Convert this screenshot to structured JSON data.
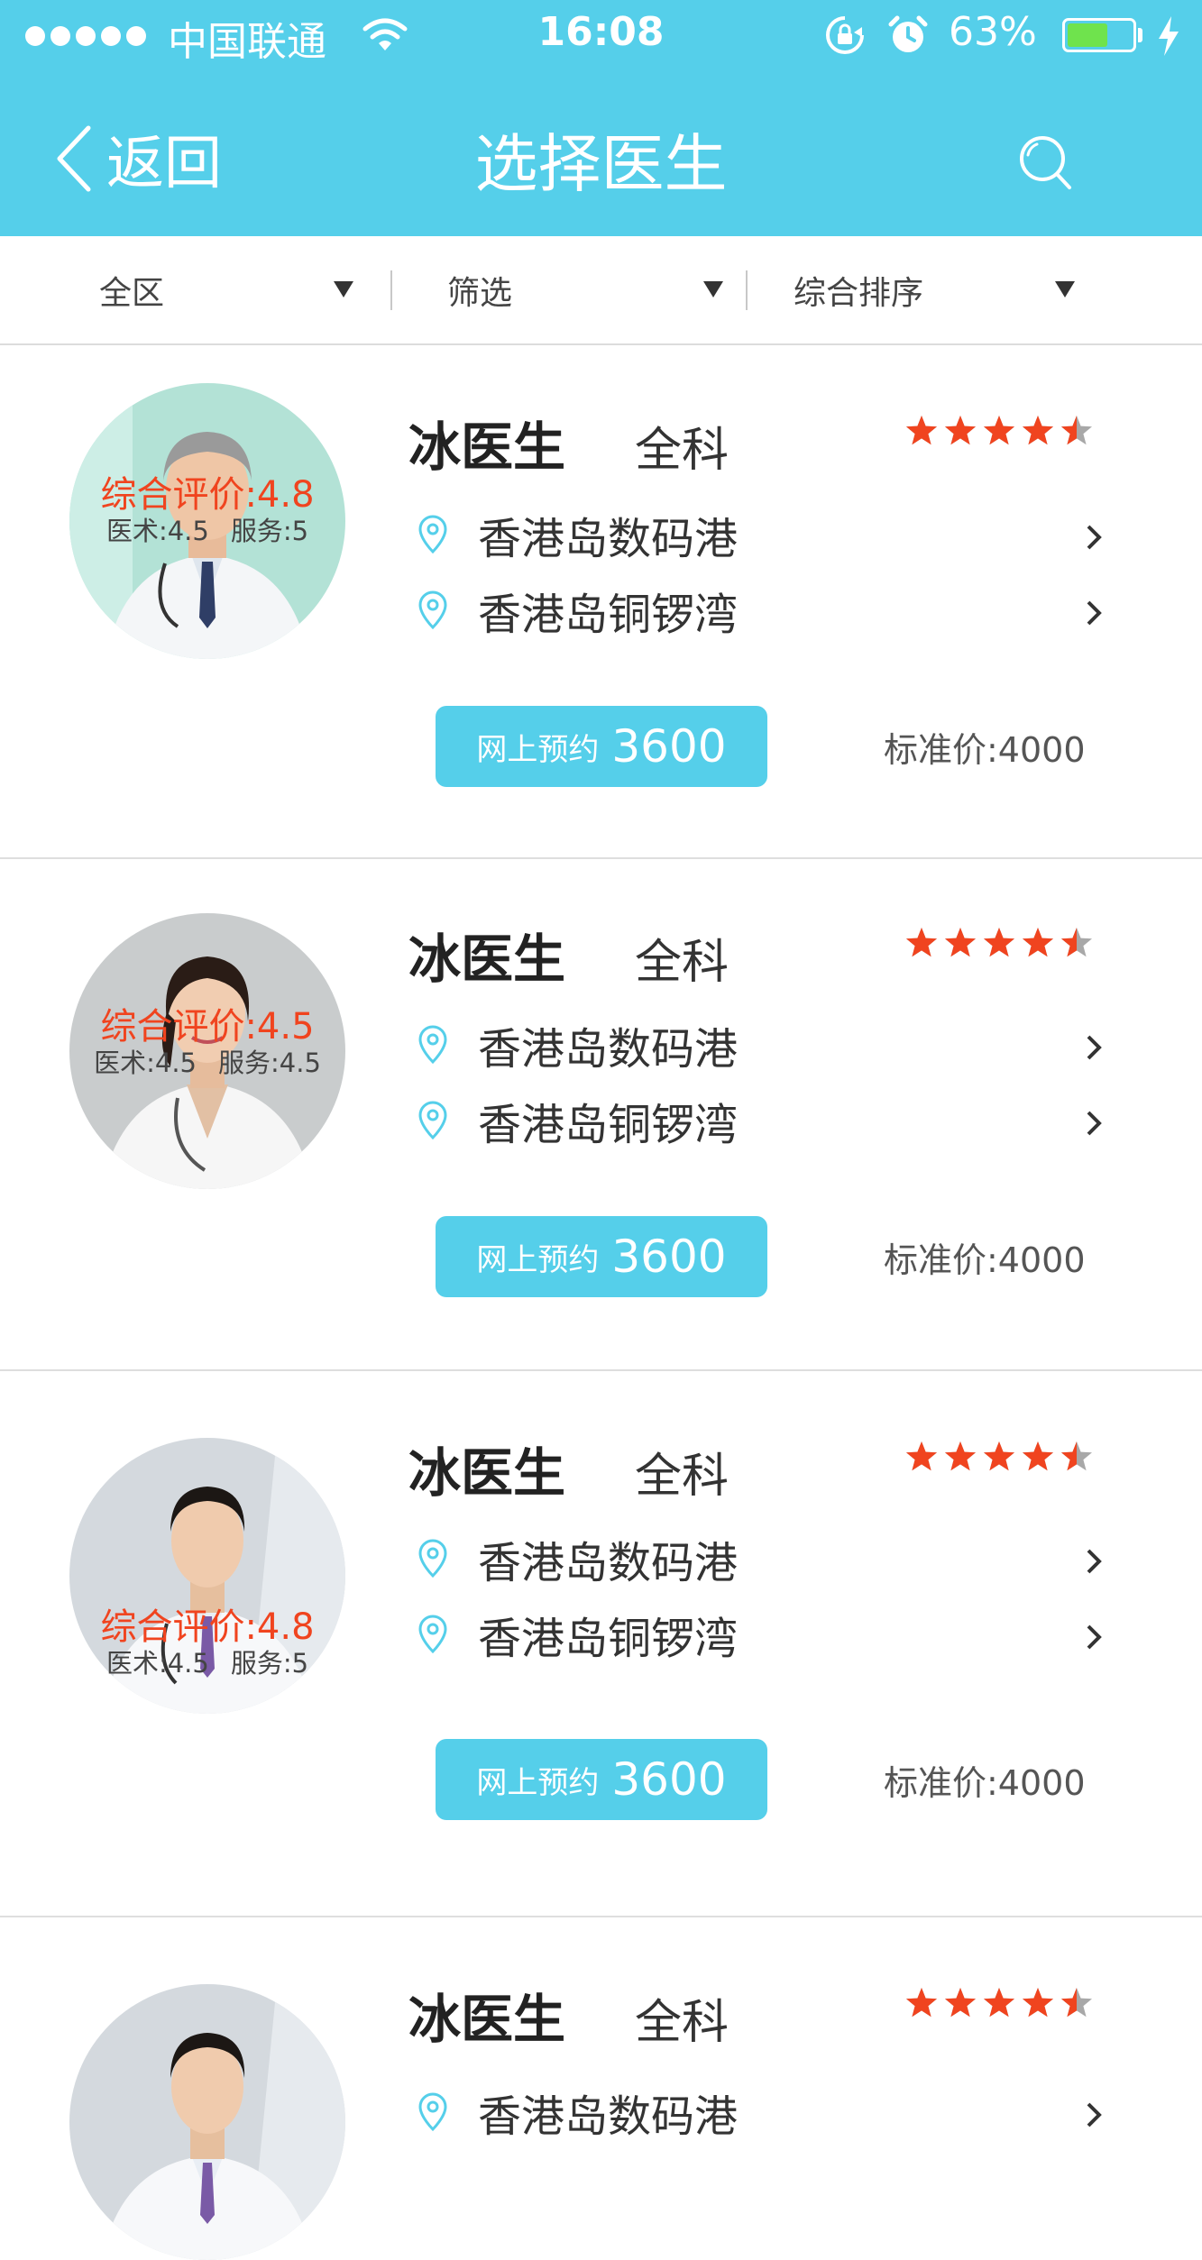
{
  "status_bar": {
    "carrier": "中国联通",
    "time": "16:08",
    "battery": "63%",
    "battery_level": 0.63,
    "icons": [
      "signal-dots-icon",
      "wifi-icon",
      "rotation-lock-icon",
      "alarm-icon",
      "battery-icon",
      "charging-bolt-icon"
    ]
  },
  "nav": {
    "back_label": "返回",
    "title": "选择医生",
    "icons": [
      "back-chevron-icon",
      "search-icon"
    ]
  },
  "filters": [
    {
      "label": "全区",
      "icon": "dropdown-triangle-icon"
    },
    {
      "label": "筛选",
      "icon": "dropdown-triangle-icon"
    },
    {
      "label": "综合排序",
      "icon": "dropdown-triangle-icon"
    }
  ],
  "doctors": [
    {
      "name": "冰医生",
      "dept": "全科",
      "rating": 4.5,
      "overall": "综合评价:4.8",
      "skill": "医术:4.5",
      "service": "服务:5",
      "locations": [
        "香港岛数码港",
        "香港岛铜锣湾"
      ],
      "book_label": "网上预约",
      "book_price": "3600",
      "standard_price": "标准价:4000",
      "avatar": "elderly-male-doctor-photo"
    },
    {
      "name": "冰医生",
      "dept": "全科",
      "rating": 4.5,
      "overall": "综合评价:4.5",
      "skill": "医术:4.5",
      "service": "服务:4.5",
      "locations": [
        "香港岛数码港",
        "香港岛铜锣湾"
      ],
      "book_label": "网上预约",
      "book_price": "3600",
      "standard_price": "标准价:4000",
      "avatar": "female-doctor-photo"
    },
    {
      "name": "冰医生",
      "dept": "全科",
      "rating": 4.5,
      "overall": "综合评价:4.8",
      "skill": "医术:4.5",
      "service": "服务:5",
      "locations": [
        "香港岛数码港",
        "香港岛铜锣湾"
      ],
      "book_label": "网上预约",
      "book_price": "3600",
      "standard_price": "标准价:4000",
      "avatar": "young-male-doctor-photo"
    },
    {
      "name": "冰医生",
      "dept": "全科",
      "rating": 4.5,
      "locations": [
        "香港岛数码港"
      ],
      "avatar": "young-male-doctor-photo"
    }
  ],
  "colors": {
    "accent": "#55cfea",
    "star": "#f0441f",
    "rating_text": "#f0441f",
    "star_empty": "#a8a8a8",
    "pin": "#55cfea"
  }
}
